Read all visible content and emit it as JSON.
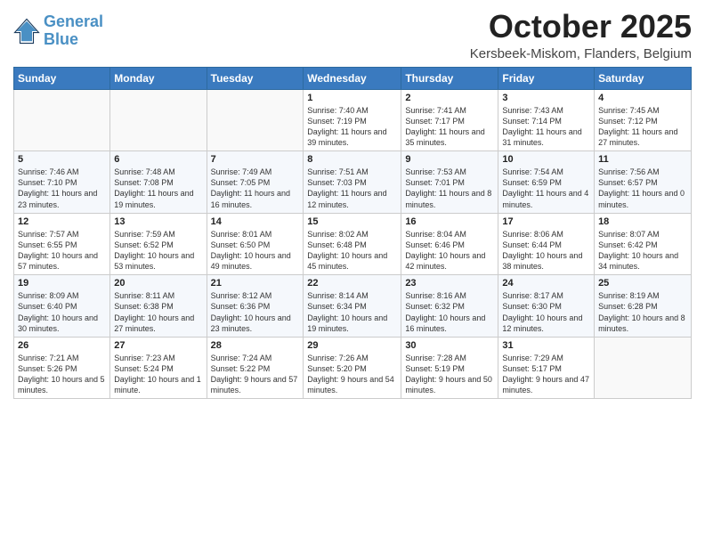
{
  "header": {
    "logo_line1": "General",
    "logo_line2": "Blue",
    "month": "October 2025",
    "location": "Kersbeek-Miskom, Flanders, Belgium"
  },
  "days_of_week": [
    "Sunday",
    "Monday",
    "Tuesday",
    "Wednesday",
    "Thursday",
    "Friday",
    "Saturday"
  ],
  "weeks": [
    [
      {
        "day": "",
        "content": ""
      },
      {
        "day": "",
        "content": ""
      },
      {
        "day": "",
        "content": ""
      },
      {
        "day": "1",
        "content": "Sunrise: 7:40 AM\nSunset: 7:19 PM\nDaylight: 11 hours and 39 minutes."
      },
      {
        "day": "2",
        "content": "Sunrise: 7:41 AM\nSunset: 7:17 PM\nDaylight: 11 hours and 35 minutes."
      },
      {
        "day": "3",
        "content": "Sunrise: 7:43 AM\nSunset: 7:14 PM\nDaylight: 11 hours and 31 minutes."
      },
      {
        "day": "4",
        "content": "Sunrise: 7:45 AM\nSunset: 7:12 PM\nDaylight: 11 hours and 27 minutes."
      }
    ],
    [
      {
        "day": "5",
        "content": "Sunrise: 7:46 AM\nSunset: 7:10 PM\nDaylight: 11 hours and 23 minutes."
      },
      {
        "day": "6",
        "content": "Sunrise: 7:48 AM\nSunset: 7:08 PM\nDaylight: 11 hours and 19 minutes."
      },
      {
        "day": "7",
        "content": "Sunrise: 7:49 AM\nSunset: 7:05 PM\nDaylight: 11 hours and 16 minutes."
      },
      {
        "day": "8",
        "content": "Sunrise: 7:51 AM\nSunset: 7:03 PM\nDaylight: 11 hours and 12 minutes."
      },
      {
        "day": "9",
        "content": "Sunrise: 7:53 AM\nSunset: 7:01 PM\nDaylight: 11 hours and 8 minutes."
      },
      {
        "day": "10",
        "content": "Sunrise: 7:54 AM\nSunset: 6:59 PM\nDaylight: 11 hours and 4 minutes."
      },
      {
        "day": "11",
        "content": "Sunrise: 7:56 AM\nSunset: 6:57 PM\nDaylight: 11 hours and 0 minutes."
      }
    ],
    [
      {
        "day": "12",
        "content": "Sunrise: 7:57 AM\nSunset: 6:55 PM\nDaylight: 10 hours and 57 minutes."
      },
      {
        "day": "13",
        "content": "Sunrise: 7:59 AM\nSunset: 6:52 PM\nDaylight: 10 hours and 53 minutes."
      },
      {
        "day": "14",
        "content": "Sunrise: 8:01 AM\nSunset: 6:50 PM\nDaylight: 10 hours and 49 minutes."
      },
      {
        "day": "15",
        "content": "Sunrise: 8:02 AM\nSunset: 6:48 PM\nDaylight: 10 hours and 45 minutes."
      },
      {
        "day": "16",
        "content": "Sunrise: 8:04 AM\nSunset: 6:46 PM\nDaylight: 10 hours and 42 minutes."
      },
      {
        "day": "17",
        "content": "Sunrise: 8:06 AM\nSunset: 6:44 PM\nDaylight: 10 hours and 38 minutes."
      },
      {
        "day": "18",
        "content": "Sunrise: 8:07 AM\nSunset: 6:42 PM\nDaylight: 10 hours and 34 minutes."
      }
    ],
    [
      {
        "day": "19",
        "content": "Sunrise: 8:09 AM\nSunset: 6:40 PM\nDaylight: 10 hours and 30 minutes."
      },
      {
        "day": "20",
        "content": "Sunrise: 8:11 AM\nSunset: 6:38 PM\nDaylight: 10 hours and 27 minutes."
      },
      {
        "day": "21",
        "content": "Sunrise: 8:12 AM\nSunset: 6:36 PM\nDaylight: 10 hours and 23 minutes."
      },
      {
        "day": "22",
        "content": "Sunrise: 8:14 AM\nSunset: 6:34 PM\nDaylight: 10 hours and 19 minutes."
      },
      {
        "day": "23",
        "content": "Sunrise: 8:16 AM\nSunset: 6:32 PM\nDaylight: 10 hours and 16 minutes."
      },
      {
        "day": "24",
        "content": "Sunrise: 8:17 AM\nSunset: 6:30 PM\nDaylight: 10 hours and 12 minutes."
      },
      {
        "day": "25",
        "content": "Sunrise: 8:19 AM\nSunset: 6:28 PM\nDaylight: 10 hours and 8 minutes."
      }
    ],
    [
      {
        "day": "26",
        "content": "Sunrise: 7:21 AM\nSunset: 5:26 PM\nDaylight: 10 hours and 5 minutes."
      },
      {
        "day": "27",
        "content": "Sunrise: 7:23 AM\nSunset: 5:24 PM\nDaylight: 10 hours and 1 minute."
      },
      {
        "day": "28",
        "content": "Sunrise: 7:24 AM\nSunset: 5:22 PM\nDaylight: 9 hours and 57 minutes."
      },
      {
        "day": "29",
        "content": "Sunrise: 7:26 AM\nSunset: 5:20 PM\nDaylight: 9 hours and 54 minutes."
      },
      {
        "day": "30",
        "content": "Sunrise: 7:28 AM\nSunset: 5:19 PM\nDaylight: 9 hours and 50 minutes."
      },
      {
        "day": "31",
        "content": "Sunrise: 7:29 AM\nSunset: 5:17 PM\nDaylight: 9 hours and 47 minutes."
      },
      {
        "day": "",
        "content": ""
      }
    ]
  ]
}
